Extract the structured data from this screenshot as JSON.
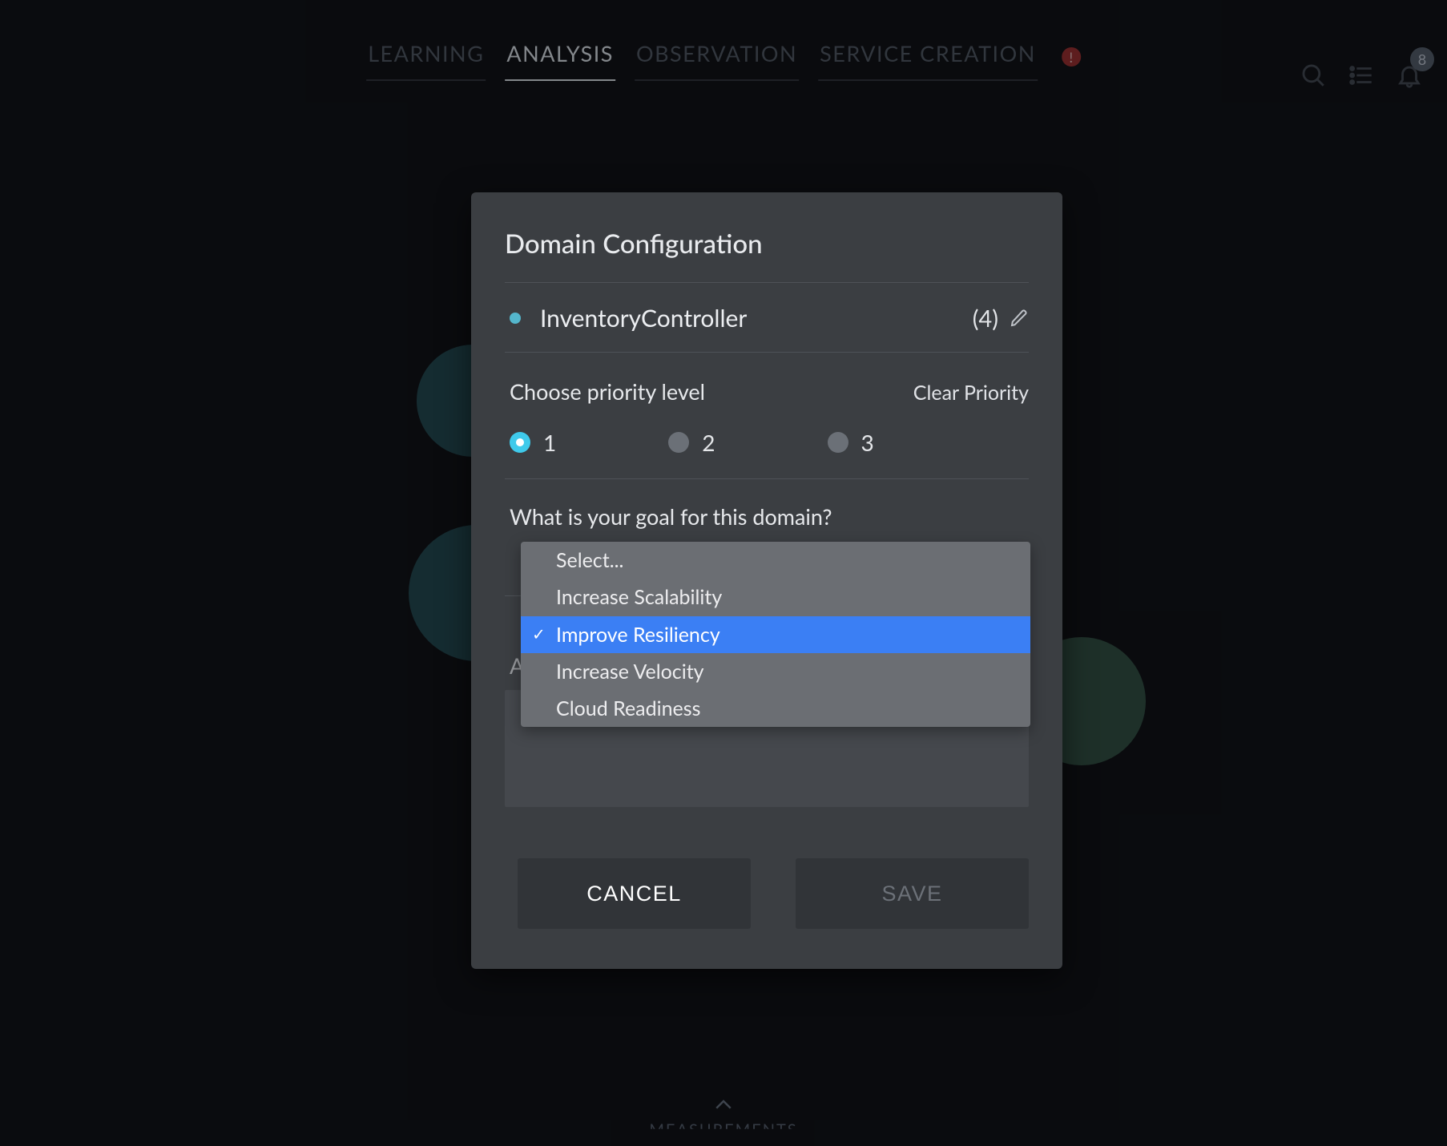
{
  "nav": {
    "tabs": [
      {
        "label": "LEARNING",
        "active": false
      },
      {
        "label": "ANALYSIS",
        "active": true
      },
      {
        "label": "OBSERVATION",
        "active": false
      },
      {
        "label": "SERVICE CREATION",
        "active": false
      }
    ],
    "alert_icon": "!",
    "notification_count": "8"
  },
  "modal": {
    "title": "Domain Configuration",
    "entity_name": "InventoryController",
    "entity_count": "(4)",
    "priority_label": "Choose priority level",
    "clear_priority": "Clear Priority",
    "priority_options": [
      "1",
      "2",
      "3"
    ],
    "priority_selected_index": 0,
    "goal_label": "What is your goal for this domain?",
    "goal_options": [
      "Select...",
      "Increase Scalability",
      "Improve Resiliency",
      "Increase Velocity",
      "Cloud Readiness"
    ],
    "goal_highlight_index": 2,
    "notes_label_fragment": "A",
    "notes_value": "",
    "cancel_label": "CANCEL",
    "save_label": "SAVE"
  },
  "footer": {
    "label": "MEASUREMENTS"
  },
  "colors": {
    "accent": "#3fcaeb",
    "highlight": "#3b7ff4",
    "modal_bg": "#3b3e42"
  }
}
